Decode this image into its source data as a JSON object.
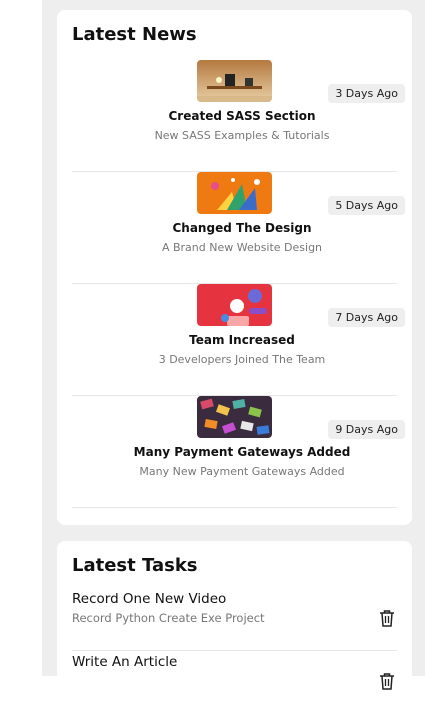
{
  "news": {
    "title": "Latest News",
    "items": [
      {
        "title": "Created SASS Section",
        "subtitle": "New SASS Examples & Tutorials",
        "badge": "3 Days Ago"
      },
      {
        "title": "Changed The Design",
        "subtitle": "A Brand New Website Design",
        "badge": "5 Days Ago"
      },
      {
        "title": "Team Increased",
        "subtitle": "3 Developers Joined The Team",
        "badge": "7 Days Ago"
      },
      {
        "title": "Many Payment Gateways Added",
        "subtitle": "Many New Payment Gateways Added",
        "badge": "9 Days Ago"
      }
    ]
  },
  "tasks": {
    "title": "Latest Tasks",
    "items": [
      {
        "title": "Record One New Video",
        "subtitle": "Record Python Create Exe Project"
      },
      {
        "title": "Write An Article",
        "subtitle": ""
      }
    ]
  },
  "icons": {
    "trash": "trash-icon"
  }
}
